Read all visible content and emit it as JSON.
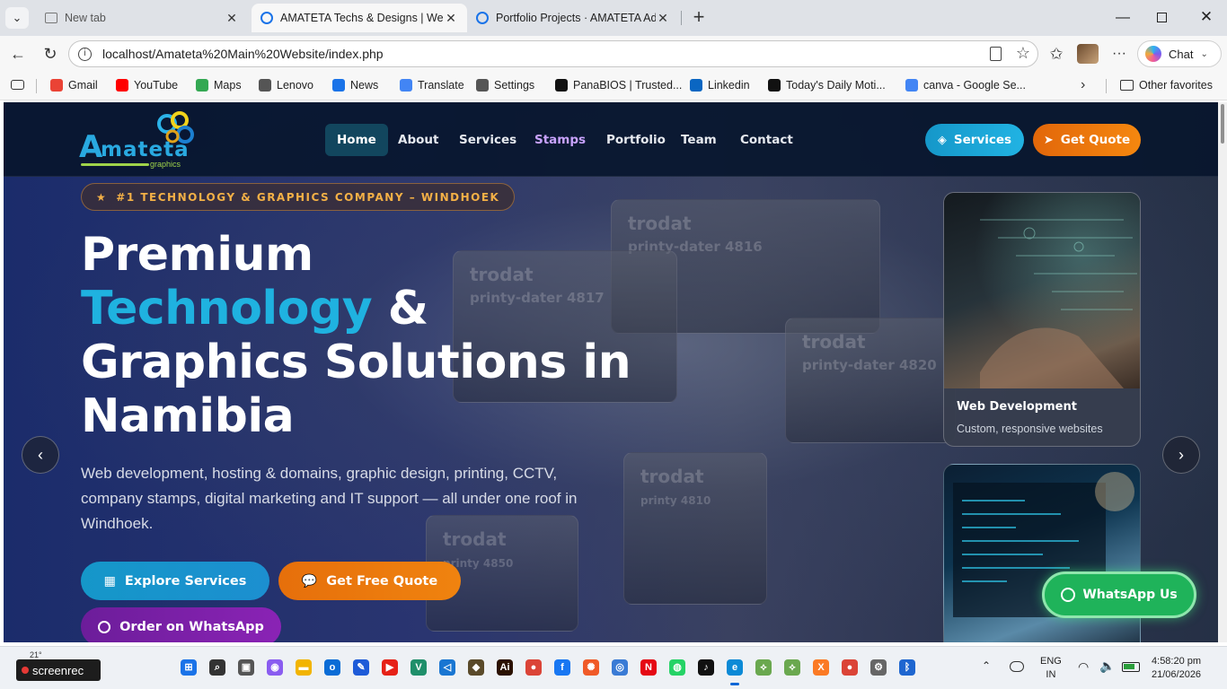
{
  "browser": {
    "tabs": [
      {
        "label": "New tab",
        "active": false
      },
      {
        "label": "AMATETA Techs & Designs | Web D",
        "active": true
      },
      {
        "label": "Portfolio Projects · AMATETA Admi",
        "active": false
      }
    ],
    "url": "localhost/Amateta%20Main%20Website/index.php",
    "profile_chat_label": "Chat",
    "bookmarks": [
      {
        "label": "Gmail",
        "color": "#ea4335"
      },
      {
        "label": "YouTube",
        "color": "#ff0000"
      },
      {
        "label": "Maps",
        "color": "#34a853"
      },
      {
        "label": "Lenovo",
        "color": "#555555"
      },
      {
        "label": "News",
        "color": "#1a73e8"
      },
      {
        "label": "Translate",
        "color": "#4285f4"
      },
      {
        "label": "Settings",
        "color": "#555555"
      },
      {
        "label": "PanaBIOS | Trusted...",
        "color": "#111111"
      },
      {
        "label": "Linkedin",
        "color": "#0a66c2"
      },
      {
        "label": "Today's Daily Moti...",
        "color": "#111111"
      },
      {
        "label": "canva - Google Se...",
        "color": "#4285f4"
      }
    ],
    "other_favorites": "Other favorites"
  },
  "site": {
    "logo": {
      "text": "mateta",
      "initial": "A",
      "subtext": "graphics"
    },
    "nav": [
      {
        "label": "Home",
        "state": "active"
      },
      {
        "label": "About",
        "state": "normal"
      },
      {
        "label": "Services",
        "state": "normal"
      },
      {
        "label": "Stamps",
        "state": "accent"
      },
      {
        "label": "Portfolio",
        "state": "normal"
      },
      {
        "label": "Team",
        "state": "normal"
      },
      {
        "label": "Contact",
        "state": "normal"
      }
    ],
    "header_buttons": {
      "services": "Services",
      "quote": "Get Quote"
    },
    "badge": "#1 TECHNOLOGY & GRAPHICS COMPANY – WINDHOEK",
    "headline": {
      "line1": "Premium",
      "line2_accent": "Technology",
      "line2_rest": " &",
      "line3": "Graphics Solutions in",
      "line4": "Namibia"
    },
    "description": "Web development, hosting & domains, graphic design, printing, CCTV, company stamps, digital marketing and IT support — all under one roof in Windhoek.",
    "cta": {
      "explore": "Explore Services",
      "quote": "Get Free Quote",
      "whatsapp": "Order on WhatsApp"
    },
    "cards": [
      {
        "title": "Web Development",
        "subtitle": "Custom, responsive websites"
      }
    ],
    "whatsapp_float": "WhatsApp Us",
    "background_stamp_labels": [
      "trodat",
      "printy-dater 4816",
      "trodat",
      "printy-dater 4817",
      "trodat",
      "printy-dater 4820",
      "trodat",
      "printy 4850",
      "trodat",
      "printy 4810"
    ],
    "colors": {
      "accent_cyan": "#1bb0dc",
      "accent_orange": "#f07a0c",
      "accent_purple": "#7a1fa6",
      "whatsapp_green": "#1fb35a",
      "badge_gold": "#f3b046"
    }
  },
  "taskbar": {
    "weather": "21°",
    "screenrec": "screenrec",
    "lang_line1": "ENG",
    "lang_line2": "IN",
    "time": "4:58:20 pm",
    "date": "21/06/2026"
  }
}
